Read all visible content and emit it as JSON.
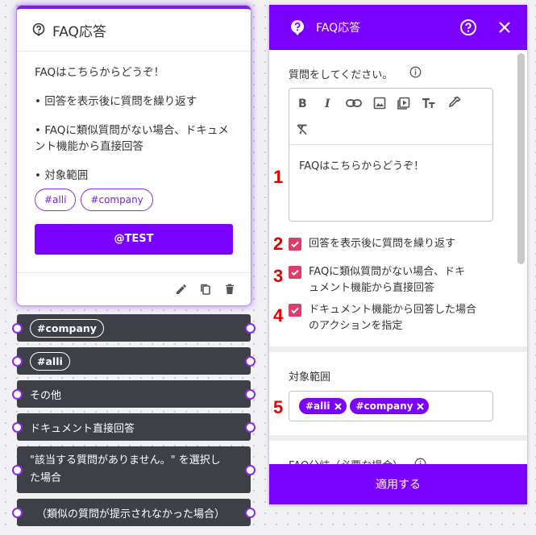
{
  "card": {
    "title": "FAQ応答",
    "lines": [
      "FAQはこちらからどうぞ！",
      "• 回答を表示後に質問を繰り返す",
      "• FAQに類似質問がない場合、ドキュメント機能から直接回答",
      "• 対象範囲"
    ],
    "tags": [
      "#alli",
      "#company"
    ],
    "test_button": "@TEST"
  },
  "options": [
    {
      "label": "#company",
      "pill": true
    },
    {
      "label": "#alli",
      "pill": true
    },
    {
      "label": "その他",
      "pill": false
    },
    {
      "label": "ドキュメント直接回答",
      "pill": false
    },
    {
      "label": "\"該当する質問がありません。\" を選択した場合",
      "pill": false
    },
    {
      "label": "（類似の質問が提示されなかった場合）",
      "pill": false
    }
  ],
  "panel": {
    "title": "FAQ応答",
    "question_label": "質問をしてください。",
    "editor_text": "FAQはこちらからどうぞ！",
    "checkboxes": [
      "回答を表示後に質問を繰り返す",
      "FAQに類似質問がない場合、ドキュメント機能から直接回答",
      "ドキュメント機能から回答した場合のアクションを指定"
    ],
    "scope_label": "対象範囲",
    "scope_chips": [
      "#alli",
      "#company"
    ],
    "faq_branch_label": "FAQ分岐（必要な場合）",
    "apply_button": "適用する"
  },
  "annotations": [
    "1",
    "2",
    "3",
    "4",
    "5"
  ],
  "colors": {
    "accent": "#7b00ff",
    "checkbox": "#e03c6a",
    "annotation": "#e00000",
    "option_bg": "#3d4047"
  }
}
